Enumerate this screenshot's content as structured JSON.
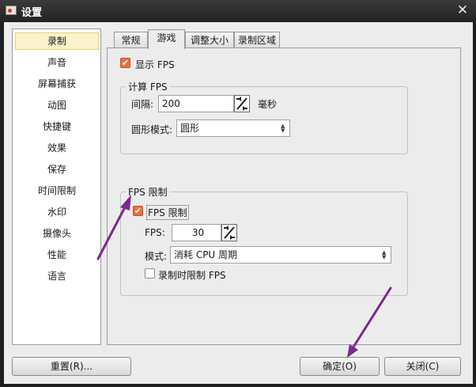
{
  "window": {
    "title": "设置"
  },
  "sidebar": {
    "items": [
      {
        "label": "录制"
      },
      {
        "label": "声音"
      },
      {
        "label": "屏幕捕获"
      },
      {
        "label": "动图"
      },
      {
        "label": "快捷键"
      },
      {
        "label": "效果"
      },
      {
        "label": "保存"
      },
      {
        "label": "时间限制"
      },
      {
        "label": "水印"
      },
      {
        "label": "摄像头"
      },
      {
        "label": "性能"
      },
      {
        "label": "语言"
      }
    ],
    "selected": "录制"
  },
  "tabs": [
    {
      "label": "常规"
    },
    {
      "label": "游戏"
    },
    {
      "label": "调整大小"
    },
    {
      "label": "录制区域"
    }
  ],
  "game": {
    "show_fps_label": "显示 FPS",
    "compute_group_title": "计算 FPS",
    "interval_label": "间隔:",
    "interval_value": "200",
    "interval_unit": "毫秒",
    "mode_label": "圆形模式:",
    "mode_value": "圆形",
    "limit_group_title": "FPS 限制",
    "limit_label": "FPS 限制",
    "fps_label": "FPS:",
    "fps_value": "30",
    "limit_mode_label": "模式:",
    "limit_mode_value": "消耗 CPU 周期",
    "limit_when_recording_label": "录制时限制 FPS"
  },
  "buttons": {
    "reset": "重置(R)...",
    "ok": "确定(O)",
    "close": "关闭(C)"
  },
  "checkbox_mark": "✔",
  "close_glyph": "✕",
  "colors": {
    "checkbox": "#e8713f",
    "arrow": "#7a2a8c",
    "titlebar": "#2a2a2a"
  }
}
